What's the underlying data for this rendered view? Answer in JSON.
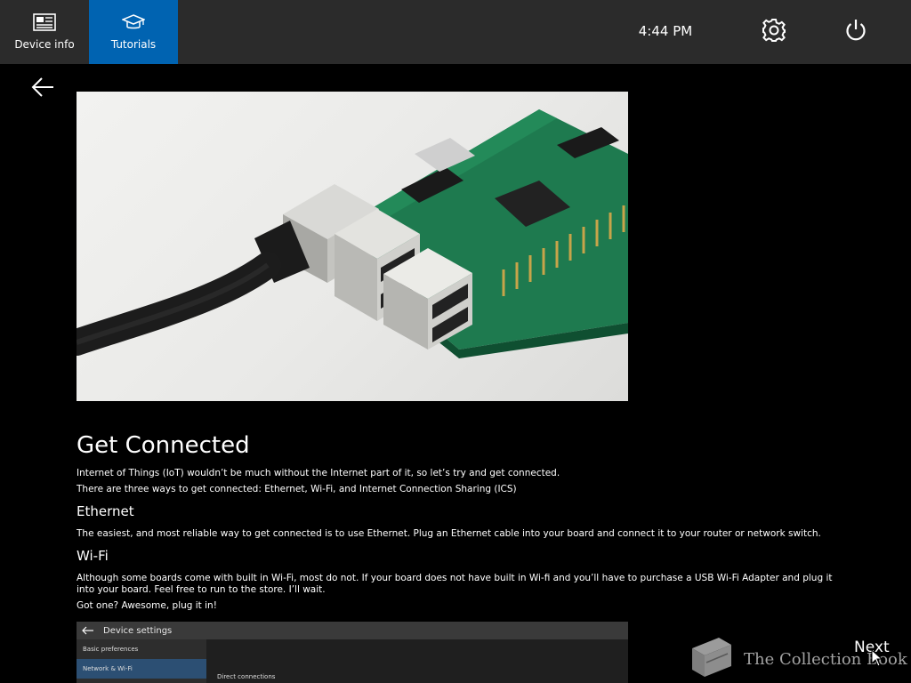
{
  "topbar": {
    "tabs": [
      {
        "label": "Device info",
        "icon": "device-info-icon",
        "active": false
      },
      {
        "label": "Tutorials",
        "icon": "graduation-cap-icon",
        "active": true
      }
    ],
    "time": "4:44 PM",
    "settings_icon": "gear-icon",
    "power_icon": "power-icon",
    "active_color": "#0063b1",
    "bar_color": "#2b2b2b"
  },
  "back_icon": "back-arrow-icon",
  "hero_image": {
    "subject": "single-board computer with ethernet cable plugged in"
  },
  "article": {
    "title": "Get Connected",
    "intro_1": "Internet of Things (IoT) wouldn’t be much without the Internet part of it, so let’s try and get connected.",
    "intro_2": "There are three ways to get connected: Ethernet, Wi-Fi, and Internet Connection Sharing (ICS)",
    "ethernet_heading": "Ethernet",
    "ethernet_text": "The easiest, and most reliable way to get connected is to use Ethernet. Plug an Ethernet cable into your board and connect it to your router or network switch.",
    "wifi_heading": "Wi-Fi",
    "wifi_text": "Although some boards come with built in Wi-Fi, most do not. If your board does not have built in Wi-fi and you’ll have to purchase a USB Wi-Fi Adapter and plug it into your board. Feel free to run to the store. I’ll wait.",
    "wifi_text_2": "Got one? Awesome, plug it in!"
  },
  "embedded_screenshot": {
    "title": "Device settings",
    "sidebar_items": [
      "Basic preferences",
      "Network & Wi-Fi"
    ],
    "main_label": "Direct connections"
  },
  "next_label": "Next",
  "watermark": {
    "text": "The Collection Book"
  }
}
